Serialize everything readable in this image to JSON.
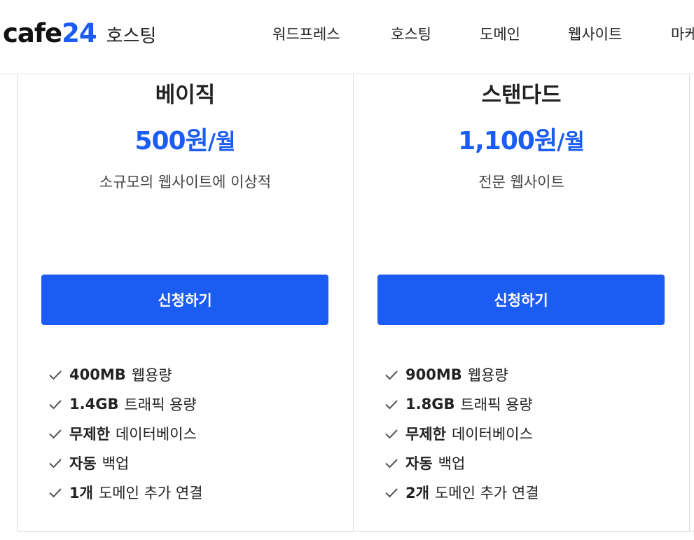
{
  "header": {
    "logo_main": "cafe",
    "logo_num": "24",
    "logo_service": "호스팅",
    "nav": [
      "워드프레스",
      "호스팅",
      "도메인",
      "웹사이트",
      "마케"
    ]
  },
  "plans": [
    {
      "name": "베이직",
      "price": "500원",
      "per": "/월",
      "description": "소규모의 웹사이트에 이상적",
      "button": "신청하기",
      "features": [
        {
          "bold": "400MB",
          "text": "웹용량"
        },
        {
          "bold": "1.4GB",
          "text": "트래픽 용량"
        },
        {
          "bold": "무제한",
          "text": "데이터베이스"
        },
        {
          "bold": "자동",
          "text": "백업"
        },
        {
          "bold": "1개",
          "text": "도메인 추가 연결"
        }
      ]
    },
    {
      "name": "스탠다드",
      "price": "1,100원",
      "per": "/월",
      "description": "전문 웹사이트",
      "button": "신청하기",
      "features": [
        {
          "bold": "900MB",
          "text": "웹용량"
        },
        {
          "bold": "1.8GB",
          "text": "트래픽 용량"
        },
        {
          "bold": "무제한",
          "text": "데이터베이스"
        },
        {
          "bold": "자동",
          "text": "백업"
        },
        {
          "bold": "2개",
          "text": "도메인 추가 연결"
        }
      ]
    }
  ],
  "colors": {
    "accent": "#1b5cf2",
    "text": "#222222",
    "border": "#dcdcdc"
  },
  "icons": {
    "feature": "checkmark-icon"
  }
}
